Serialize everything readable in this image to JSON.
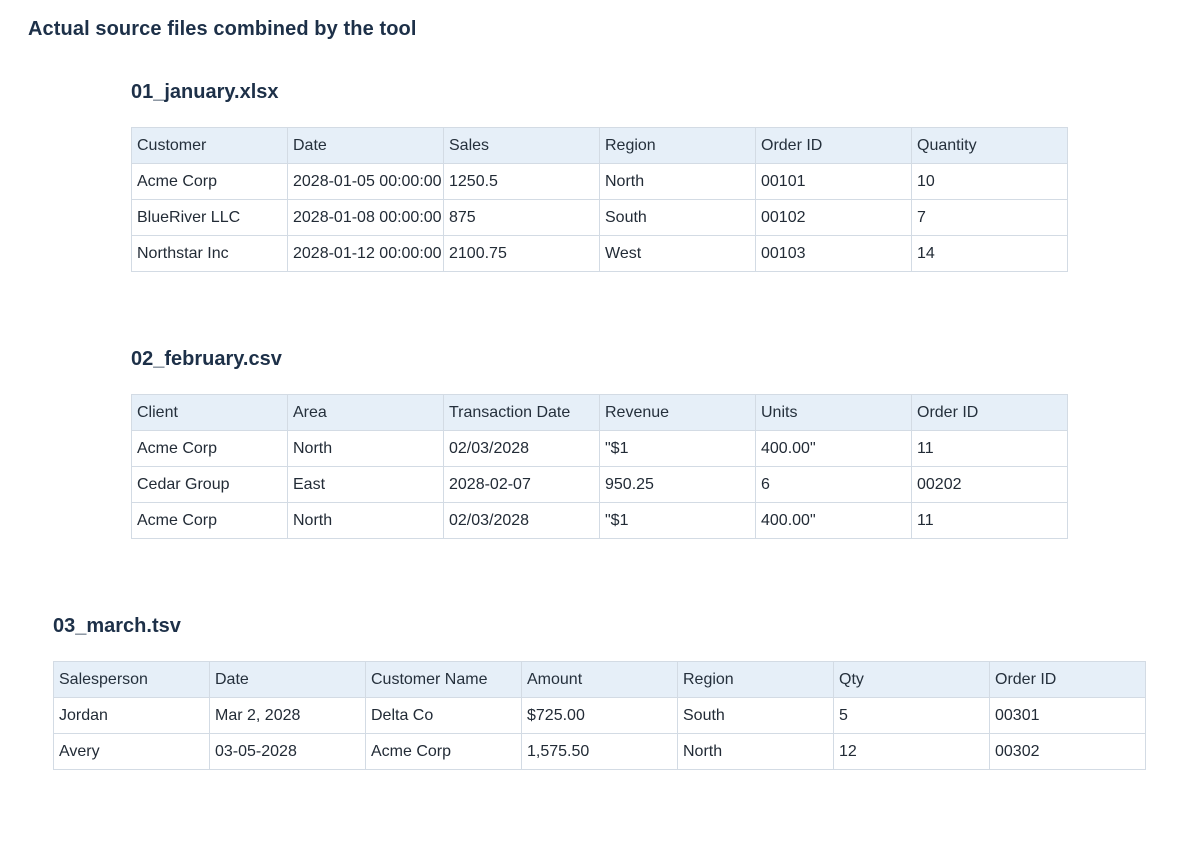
{
  "page": {
    "title": "Actual source files combined by the tool"
  },
  "files": [
    {
      "name": "01_january.xlsx",
      "columns": [
        "Customer",
        "Date",
        "Sales",
        "Region",
        "Order ID",
        "Quantity"
      ],
      "rows": [
        [
          "Acme Corp",
          "2028-01-05 00:00:00",
          "1250.5",
          "North",
          "00101",
          "10"
        ],
        [
          "BlueRiver LLC",
          "2028-01-08 00:00:00",
          "875",
          "South",
          "00102",
          "7"
        ],
        [
          "Northstar Inc",
          "2028-01-12 00:00:00",
          "2100.75",
          "West",
          "00103",
          "14"
        ]
      ]
    },
    {
      "name": "02_february.csv",
      "columns": [
        "Client",
        "Area",
        "Transaction Date",
        "Revenue",
        "Units",
        "Order ID"
      ],
      "rows": [
        [
          "Acme Corp",
          "North",
          "02/03/2028",
          "\"$1",
          "400.00\"",
          "11"
        ],
        [
          "Cedar Group",
          "East",
          "2028-02-07",
          "950.25",
          "6",
          "00202"
        ],
        [
          "Acme Corp",
          "North",
          "02/03/2028",
          "\"$1",
          "400.00\"",
          "11"
        ]
      ]
    },
    {
      "name": "03_march.tsv",
      "columns": [
        "Salesperson",
        "Date",
        "Customer Name",
        "Amount",
        "Region",
        "Qty",
        "Order ID"
      ],
      "rows": [
        [
          "Jordan",
          "Mar 2, 2028",
          "Delta Co",
          "$725.00",
          "South",
          "5",
          "00301"
        ],
        [
          "Avery",
          "03-05-2028",
          "Acme Corp",
          "1,575.50",
          "North",
          "12",
          "00302"
        ]
      ]
    }
  ]
}
